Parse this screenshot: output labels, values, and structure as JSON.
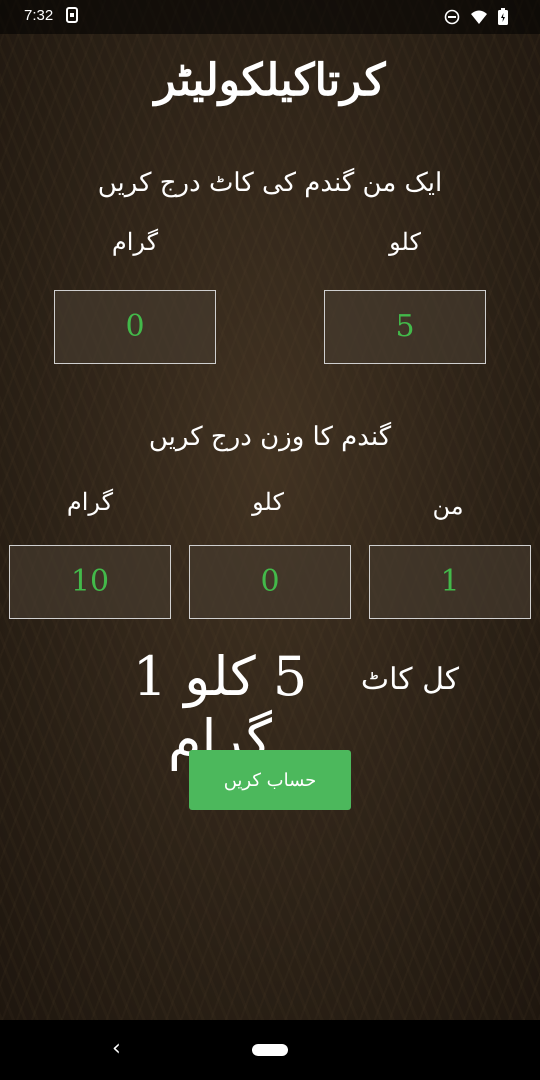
{
  "status_bar": {
    "time": "7:32"
  },
  "header": {
    "title": "کرتاکیلکولیٹر"
  },
  "cut_section": {
    "heading": "ایک من گندم کی کاٹ درج کریں",
    "kilo_label": "کلو",
    "gram_label": "گرام",
    "kilo_value": "5",
    "gram_value": "0"
  },
  "weight_section": {
    "heading": "گندم کا وزن درج کریں",
    "mann_label": "من",
    "kilo_label": "کلو",
    "gram_label": "گرام",
    "mann_value": "1",
    "kilo_value": "0",
    "gram_value": "10"
  },
  "result": {
    "label": "کل کاٹ",
    "value": "5 کلو 1 گرام"
  },
  "button": {
    "label": "حساب کریں"
  },
  "colors": {
    "input_text": "#43b94a",
    "button_bg": "#4cb85c",
    "text": "#ffffff"
  }
}
